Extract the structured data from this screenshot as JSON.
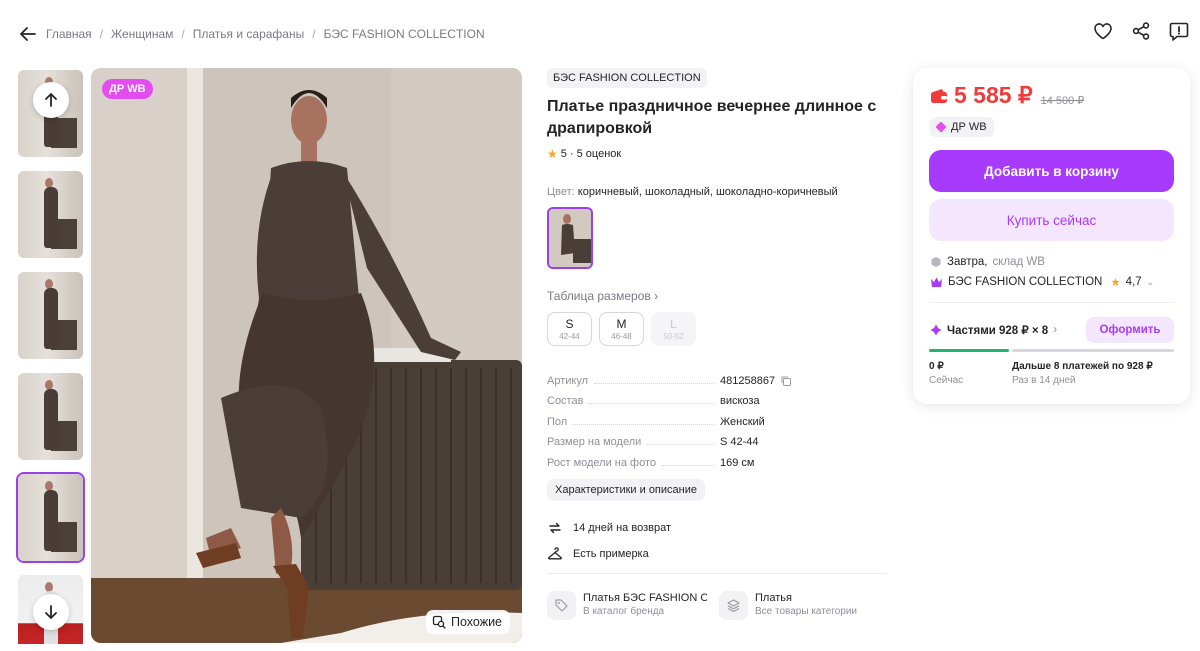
{
  "breadcrumb": {
    "items": [
      "Главная",
      "Женщинам",
      "Платья и сарафаны",
      "БЭС FASHION COLLECTION"
    ],
    "separator": "/"
  },
  "icons": {
    "back": "arrow-left-icon",
    "favorite": "heart-icon",
    "share": "share-icon",
    "report": "report-icon"
  },
  "gallery": {
    "badge": "ДР WB",
    "similar_label": "Похожие",
    "active_thumb_index": 4,
    "thumb_count": 6
  },
  "product": {
    "brand": "БЭС FASHION COLLECTION",
    "title": "Платье праздничное вечернее длинное с драпировкой",
    "rating": "5",
    "rating_count": "· 5 оценок",
    "color_label": "Цвет:",
    "color_value": "коричневый, шоколадный, шоколадно-коричневый",
    "size_table_label": "Таблица размеров",
    "sizes": [
      {
        "size": "S",
        "range": "42-44",
        "available": true
      },
      {
        "size": "M",
        "range": "46-48",
        "available": true
      },
      {
        "size": "L",
        "range": "50-52",
        "available": false
      }
    ],
    "specs": [
      {
        "key": "Артикул",
        "value": "481258867"
      },
      {
        "key": "Состав",
        "value": "вискоза"
      },
      {
        "key": "Пол",
        "value": "Женский"
      },
      {
        "key": "Размер на модели",
        "value": "S 42-44"
      },
      {
        "key": "Рост модели на фото",
        "value": "169 см"
      }
    ],
    "characteristics_label": "Характеристики и описание",
    "features": [
      {
        "icon": "return-arrows-icon",
        "text": "14 дней на возврат"
      },
      {
        "icon": "hanger-icon",
        "text": "Есть примерка"
      }
    ],
    "catalogs": [
      {
        "icon": "tag-icon",
        "title": "Платья БЭС FASHION COLLECTION",
        "subtitle": "В каталог бренда"
      },
      {
        "icon": "layers-icon",
        "title": "Платья",
        "subtitle": "Все товары категории"
      }
    ]
  },
  "buy_card": {
    "price": "5 585 ₽",
    "old_price": "14 500 ₽",
    "drwb_label": "ДР WB",
    "add_to_cart": "Добавить в корзину",
    "buy_now": "Купить сейчас",
    "delivery_day": "Завтра,",
    "delivery_place": "склад WB",
    "seller_name": "БЭС FASHION COLLECTION",
    "seller_rating": "4,7",
    "installments_label": "Частями 928 ₽ × 8",
    "order_label": "Оформить",
    "pay_now_amount": "0 ₽",
    "pay_now_label": "Сейчас",
    "pay_later_amount": "Дальше 8 платежей по 928 ₽",
    "pay_later_label": "Раз в 14 дней",
    "colors": {
      "accent": "#a73afd",
      "price": "#f13a3a",
      "progress_done": "#1fb476",
      "progress_rest": "#d6d6dc"
    }
  }
}
